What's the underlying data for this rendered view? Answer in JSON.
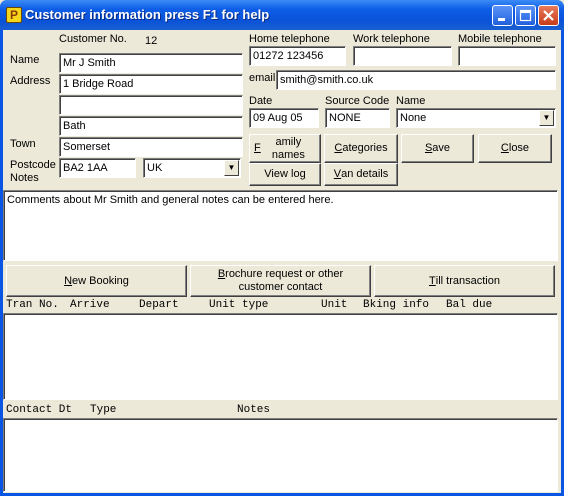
{
  "window": {
    "title": "Customer information press F1 for help",
    "icon_letter": "P"
  },
  "customer": {
    "customer_no_label": "Customer No.",
    "customer_no": "12",
    "name_label": "Name",
    "name": "Mr J Smith",
    "address_label": "Address",
    "address1": "1 Bridge Road",
    "address2": "",
    "address3": "Bath",
    "town_label": "Town",
    "town": "Somerset",
    "postcode_label": "Postcode",
    "notes_label": "Notes",
    "postcode": "BA2 1AA",
    "country": "UK"
  },
  "contact": {
    "home_label": "Home telephone",
    "home": "01272 123456",
    "work_label": "Work telephone",
    "work": "",
    "mobile_label": "Mobile telephone",
    "mobile": "",
    "email_label": "email",
    "email": "smith@smith.co.uk",
    "date_label": "Date",
    "date": "09 Aug 05",
    "source_label": "Source Code",
    "source": "NONE",
    "name2_label": "Name",
    "name2": "None"
  },
  "buttons": {
    "family_a": "F",
    "family_b": "amily names",
    "categories_a": "C",
    "categories_b": "ategories",
    "save_a": "S",
    "save_b": "ave",
    "close_a": "C",
    "close_b": "lose",
    "viewlog_a": "View lo",
    "viewlog_u": "g",
    "van_a": "V",
    "van_b": "an details",
    "newbooking_a": "N",
    "newbooking_b": "ew Booking",
    "brochure_a": "B",
    "brochure_b": "rochure request or other customer contact",
    "till_a": "T",
    "till_b": "ill transaction"
  },
  "notes_text": "Comments about Mr Smith and general notes can be entered here.",
  "bookings_header": [
    "Tran No.",
    "Arrive",
    "Depart",
    "Unit type",
    "Unit",
    "Bking info",
    "Bal due"
  ],
  "contacts_header": [
    "Contact Dt",
    "Type",
    "Notes"
  ]
}
